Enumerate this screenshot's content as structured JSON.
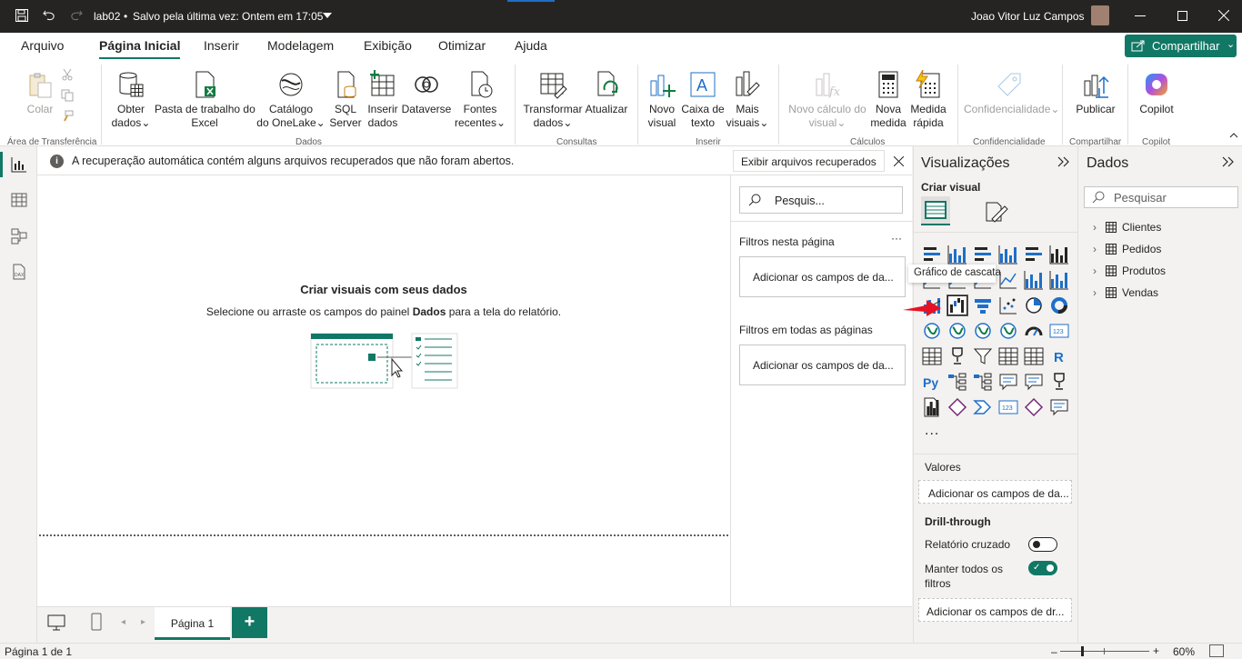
{
  "titlebar": {
    "file_name": "lab02",
    "save_status": "Salvo pela última vez: Ontem em 17:05",
    "user_name": "Joao Vitor Luz Campos"
  },
  "menu": {
    "tabs": [
      "Arquivo",
      "Página Inicial",
      "Inserir",
      "Modelagem",
      "Exibição",
      "Otimizar",
      "Ajuda"
    ],
    "share_label": "Compartilhar"
  },
  "ribbon": {
    "clipboard": {
      "paste": "Colar",
      "group": "Área de Transferência"
    },
    "data": {
      "get_data": [
        "Obter",
        "dados"
      ],
      "excel": [
        "Pasta de trabalho do",
        "Excel"
      ],
      "onelake": [
        "Catálogo",
        "do OneLake"
      ],
      "sql": [
        "SQL",
        "Server"
      ],
      "enter_data": [
        "Inserir",
        "dados"
      ],
      "dataverse": "Dataverse",
      "recent": [
        "Fontes",
        "recentes"
      ],
      "group": "Dados"
    },
    "queries": {
      "transform": [
        "Transformar",
        "dados"
      ],
      "refresh": "Atualizar",
      "group": "Consultas"
    },
    "insert": {
      "new_visual": [
        "Novo",
        "visual"
      ],
      "text_box": [
        "Caixa de",
        "texto"
      ],
      "more_visuals": [
        "Mais",
        "visuais"
      ],
      "group": "Inserir"
    },
    "calc": {
      "new_calc": [
        "Novo cálculo do",
        "visual"
      ],
      "new_measure": [
        "Nova",
        "medida"
      ],
      "quick_measure": [
        "Medida",
        "rápida"
      ],
      "group": "Cálculos"
    },
    "sensitivity": {
      "label": "Confidencialidade",
      "group": "Confidencialidade"
    },
    "share": {
      "publish": "Publicar",
      "group": "Compartilhar"
    },
    "copilot": {
      "label": "Copilot",
      "group": "Copilot"
    }
  },
  "infobar": {
    "message": "A recuperação automática contém alguns arquivos recuperados que não foram abertos.",
    "button": "Exibir arquivos recuperados"
  },
  "canvas": {
    "title": "Criar visuais com seus dados",
    "subtitle_pre": "Selecione ou arraste os campos do painel ",
    "subtitle_bold": "Dados",
    "subtitle_post": " para a tela do relatório."
  },
  "filters": {
    "search_placeholder": "Pesquis...",
    "this_page": "Filtros nesta página",
    "this_page_box": "Adicionar os campos de da...",
    "all_pages": "Filtros em todas as páginas",
    "all_pages_box": "Adicionar os campos de da..."
  },
  "pages": {
    "tab": "Página 1",
    "add": "+"
  },
  "status": {
    "page_info": "Página 1 de 1",
    "zoom": "60%"
  },
  "visualizations": {
    "title": "Visualizações",
    "build_visual": "Criar visual",
    "tooltip": "Gráfico de cascata",
    "more": "...",
    "values_label": "Valores",
    "values_box": "Adicionar os campos de da...",
    "drillthrough": "Drill-through",
    "cross_report": "Relatório cruzado",
    "keep_filters": [
      "Manter todos os",
      "filtros"
    ],
    "drill_box": "Adicionar os campos de dr...",
    "cross_report_on": false,
    "keep_filters_on": true
  },
  "data_pane": {
    "title": "Dados",
    "search_placeholder": "Pesquisar",
    "tables": [
      "Clientes",
      "Pedidos",
      "Produtos",
      "Vendas"
    ]
  },
  "colors": {
    "accent": "#117865",
    "arrow": "#e81123",
    "blue": "#1e6fc8"
  }
}
